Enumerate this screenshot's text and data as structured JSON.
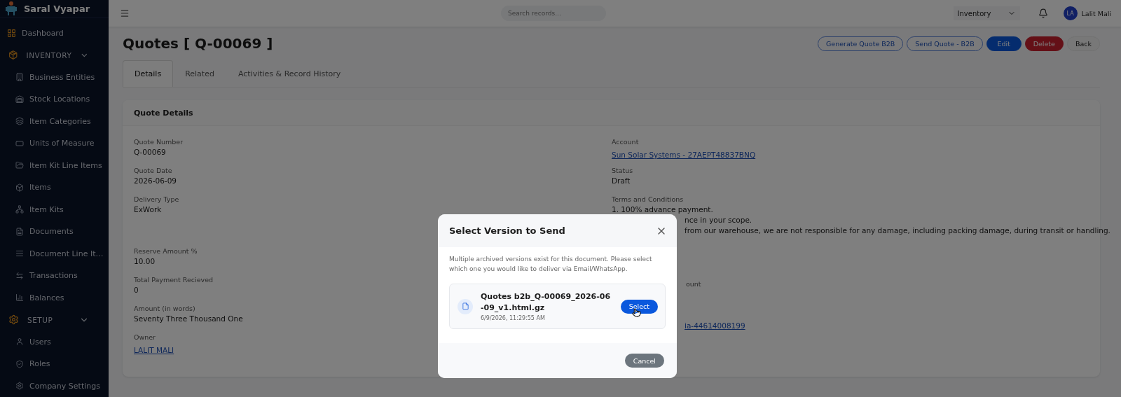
{
  "app": {
    "name": "Saral Vyapar"
  },
  "sidebar": {
    "items": [
      {
        "kind": "link",
        "label": "Dashboard"
      },
      {
        "kind": "group",
        "label": "INVENTORY",
        "expanded": true,
        "children": [
          {
            "label": "Business Entities"
          },
          {
            "label": "Stock Locations"
          },
          {
            "label": "Item Categories"
          },
          {
            "label": "Units of Measure"
          },
          {
            "label": "Item Kit Line Items"
          },
          {
            "label": "Items"
          },
          {
            "label": "Item Kits"
          },
          {
            "label": "Documents"
          },
          {
            "label": "Document Line It…"
          },
          {
            "label": "Transactions"
          },
          {
            "label": "Balances"
          }
        ]
      },
      {
        "kind": "group",
        "label": "SETUP",
        "expanded": true,
        "children": [
          {
            "label": "Users"
          },
          {
            "label": "Roles"
          },
          {
            "label": "Company Settings"
          }
        ]
      }
    ]
  },
  "topbar": {
    "search": {
      "placeholder": "Search records..."
    },
    "module_select": {
      "value": "Inventory"
    },
    "user": {
      "initials": "LA",
      "name": "Lalit Mali"
    }
  },
  "page": {
    "title": "Quotes [ Q-00069 ]",
    "actions": [
      {
        "label": "Generate Quote B2B",
        "kind": "outline"
      },
      {
        "label": "Send Quote - B2B",
        "kind": "outline"
      },
      {
        "label": "Edit",
        "kind": "primary"
      },
      {
        "label": "Delete",
        "kind": "danger"
      },
      {
        "label": "Back",
        "kind": "plain"
      }
    ],
    "tabs": [
      {
        "label": "Details",
        "selected": true
      },
      {
        "label": "Related",
        "selected": false
      },
      {
        "label": "Activities & Record History",
        "selected": false
      }
    ]
  },
  "card": {
    "title": "Quote Details",
    "left_fields": [
      {
        "label": "Quote Number",
        "value": "Q-00069",
        "kind": "text"
      },
      {
        "label": "Quote Date",
        "value": "2026-06-09",
        "kind": "text"
      },
      {
        "label": "Delivery Type",
        "value": "ExWork",
        "kind": "text"
      },
      {
        "label": "Reserve Amount %",
        "value": "10.00",
        "kind": "text"
      },
      {
        "label": "Total Payment Recieved",
        "value": "0",
        "kind": "text"
      },
      {
        "label": "Amount (in words)",
        "value": "Seventy Three Thousand One",
        "kind": "text"
      },
      {
        "label": "Owner",
        "value": "LALIT MALI",
        "kind": "link"
      }
    ],
    "right_fields": [
      {
        "label": "Account",
        "value": "Sun Solar Systems - 27AEPT48837BNQ",
        "kind": "link"
      },
      {
        "label": "Status",
        "value": "Draft",
        "kind": "text"
      },
      {
        "label": "Terms and Conditions",
        "lines": [
          "1. 100% advance payment.",
          "nce in your scope.",
          "from our warehouse, we are not responsible for any damage, including packing damage, during transit or handling."
        ],
        "kind": "lines"
      },
      {
        "label": "ount",
        "kind": "clipped_label"
      },
      {
        "value": "ia-44614008199",
        "kind": "clipped_link"
      }
    ]
  },
  "modal": {
    "title": "Select Version to Send",
    "message": "Multiple archived versions exist for this document. Please select which one you would like to deliver via Email/WhatsApp.",
    "versions": [
      {
        "name": "Quotes b2b_Q-00069_2026-06-09_v1.html.gz",
        "timestamp": "6/9/2026, 11:29:55 AM",
        "button": "Select"
      }
    ],
    "cancel": "Cancel"
  }
}
